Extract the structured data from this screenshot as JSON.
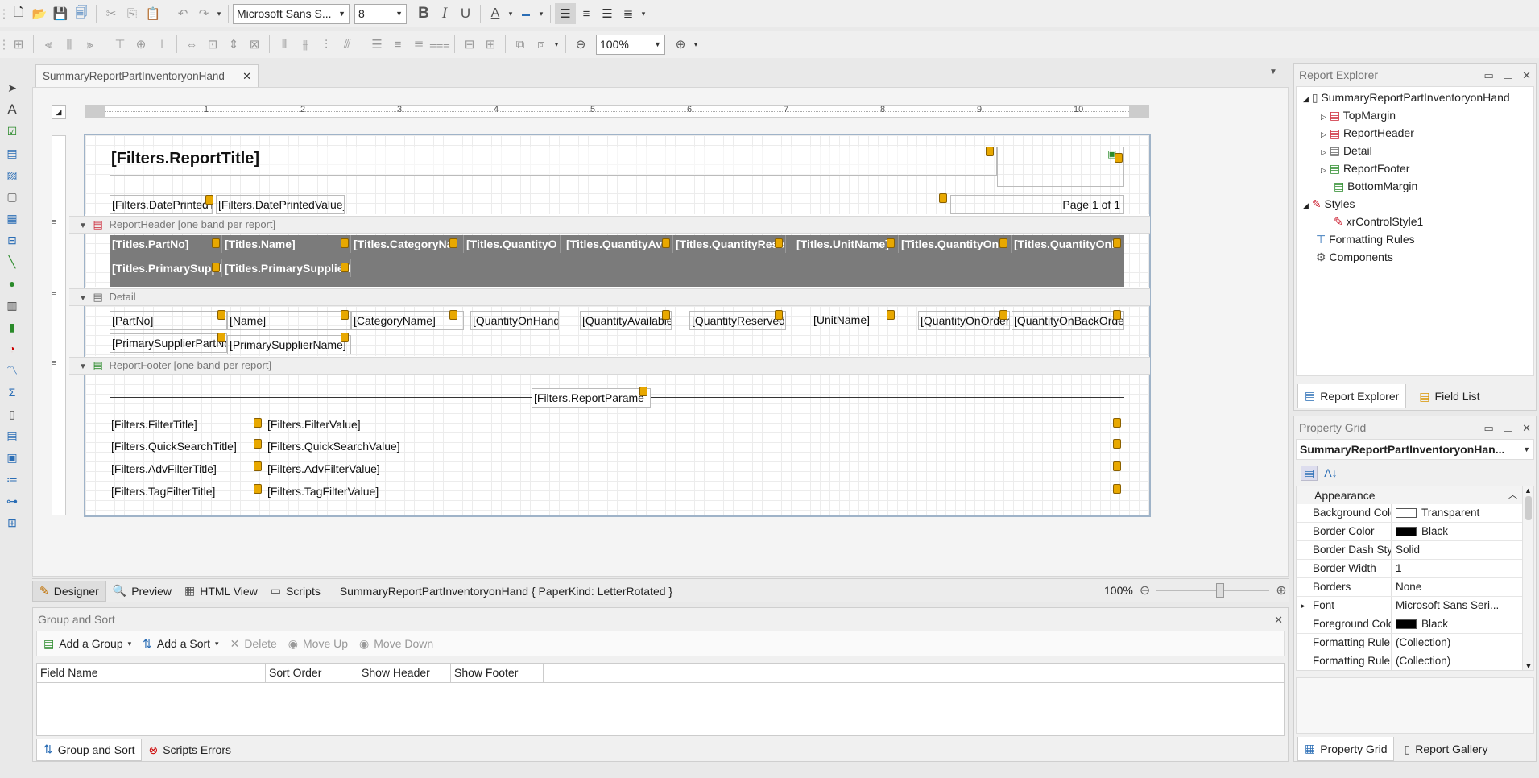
{
  "toolbar1": {
    "font_name": "Microsoft Sans S...",
    "font_size": "8",
    "bold": "B",
    "italic": "I",
    "underline": "U",
    "font_color": "A"
  },
  "toolbar2": {
    "zoom": "100%"
  },
  "document_tab": {
    "title": "SummaryReportPartInventoryonHand",
    "close": "✕"
  },
  "ruler": {
    "marks": [
      "1",
      "2",
      "3",
      "4",
      "5",
      "6",
      "7",
      "8",
      "9",
      "10"
    ]
  },
  "report": {
    "title_field": "[Filters.ReportTitle]",
    "date_printed_title": "[Filters.DatePrintedTi",
    "date_printed_value": "[Filters.DatePrintedValue]",
    "page_info": "Page 1 of 1",
    "report_header_band": "ReportHeader [one band per report]",
    "header_titles": [
      "[Titles.PartNo]",
      "[Titles.Name]",
      "[Titles.CategoryNa",
      "[Titles.QuantityO",
      "[Titles.QuantityAva",
      "[Titles.QuantityRese",
      "[Titles.UnitName]",
      "[Titles.QuantityOnO",
      "[Titles.QuantityOnB"
    ],
    "header_titles_row2": [
      "[Titles.PrimarySuppl",
      "[Titles.PrimarySupplierI"
    ],
    "detail_band": "Detail",
    "detail_fields": [
      "[PartNo]",
      "[Name]",
      "[CategoryName]",
      "[QuantityOnHand",
      "[QuantityAvailable",
      "[QuantityReserved",
      "[UnitName]",
      "[QuantityOnOrder",
      "[QuantityOnBackOrde"
    ],
    "detail_fields_row2": [
      "[PrimarySupplierPartNo",
      "[PrimarySupplierName]"
    ],
    "report_footer_band": "ReportFooter [one band per report]",
    "report_params": "[Filters.ReportParame",
    "filter_rows": [
      {
        "title": "[Filters.FilterTitle]",
        "value": "[Filters.FilterValue]"
      },
      {
        "title": "[Filters.QuickSearchTitle]",
        "value": "[Filters.QuickSearchValue]"
      },
      {
        "title": "[Filters.AdvFilterTitle]",
        "value": "[Filters.AdvFilterValue]"
      },
      {
        "title": "[Filters.TagFilterTitle]",
        "value": "[Filters.TagFilterValue]"
      }
    ]
  },
  "bottom_tabs": {
    "designer": "Designer",
    "preview": "Preview",
    "html_view": "HTML View",
    "scripts": "Scripts",
    "status": "SummaryReportPartInventoryonHand { PaperKind: LetterRotated }",
    "zoom": "100%"
  },
  "group_sort": {
    "title": "Group and Sort",
    "add_group": "Add a Group",
    "add_sort": "Add a Sort",
    "delete": "Delete",
    "move_up": "Move Up",
    "move_down": "Move Down",
    "columns": [
      "Field Name",
      "Sort Order",
      "Show Header",
      "Show Footer"
    ],
    "tab_group_sort": "Group and Sort",
    "tab_scripts_errors": "Scripts Errors"
  },
  "report_explorer": {
    "title": "Report Explorer",
    "root": "SummaryReportPartInventoryonHand",
    "items": [
      "TopMargin",
      "ReportHeader",
      "Detail",
      "ReportFooter",
      "BottomMargin"
    ],
    "styles": "Styles",
    "style_item": "xrControlStyle1",
    "formatting_rules": "Formatting Rules",
    "components": "Components",
    "tab_explorer": "Report Explorer",
    "tab_field_list": "Field List"
  },
  "property_grid": {
    "title": "Property Grid",
    "selected": "SummaryReportPartInventoryonHan...",
    "category": "Appearance",
    "rows": [
      {
        "name": "Background Colo",
        "value": "Transparent",
        "swatch": "#ffffff"
      },
      {
        "name": "Border Color",
        "value": "Black",
        "swatch": "#000000"
      },
      {
        "name": "Border Dash Sty",
        "value": "Solid",
        "swatch": ""
      },
      {
        "name": "Border Width",
        "value": "1",
        "swatch": ""
      },
      {
        "name": "Borders",
        "value": "None",
        "swatch": ""
      },
      {
        "name": "Font",
        "value": "Microsoft Sans Seri...",
        "swatch": ""
      },
      {
        "name": "Foreground Colo",
        "value": "Black",
        "swatch": "#000000"
      },
      {
        "name": "Formatting Rule",
        "value": "(Collection)",
        "swatch": ""
      },
      {
        "name": "Formatting Rule",
        "value": "(Collection)",
        "swatch": ""
      }
    ],
    "tab_property_grid": "Property Grid",
    "tab_report_gallery": "Report Gallery"
  },
  "colors": {
    "header_band_bg": "#7b7b7b",
    "accent": "#2a6db5"
  }
}
